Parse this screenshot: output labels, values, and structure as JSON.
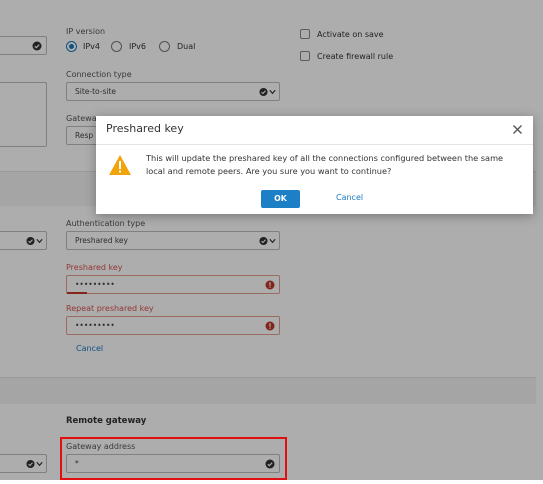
{
  "form": {
    "ip_version_label": "IP version",
    "ip_options": [
      "IPv4",
      "IPv6",
      "Dual"
    ],
    "activate_on_save": "Activate on save",
    "create_firewall_rule": "Create firewall rule",
    "connection_type_label": "Connection type",
    "connection_type_value": "Site-to-site",
    "gateway_label_partial": "Gatewa",
    "gateway_value_partial": "Resp",
    "authentication_type_label": "Authentication type",
    "authentication_type_value": "Preshared key",
    "preshared_key_label": "Preshared key",
    "preshared_key_value": "•••••••••",
    "repeat_preshared_key_label": "Repeat preshared key",
    "repeat_preshared_key_value": "•••••••••",
    "cancel_link": "Cancel",
    "remote_gateway_heading": "Remote gateway",
    "gateway_address_label": "Gateway address",
    "gateway_address_value": "*"
  },
  "dialog": {
    "title": "Preshared key",
    "message": "This will update the preshared key of all the connections configured between the same local and remote peers. Are you sure you want to continue?",
    "ok_label": "OK",
    "cancel_label": "Cancel"
  },
  "colors": {
    "accent": "#1d80c6",
    "error": "#d9534f",
    "highlight": "#e01010",
    "warning": "#f0a30a"
  },
  "icons": [
    "check-circle-icon",
    "chevron-down-icon",
    "warning-field-icon",
    "warning-triangle-icon",
    "close-icon"
  ]
}
